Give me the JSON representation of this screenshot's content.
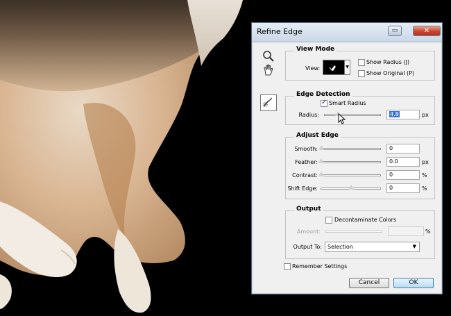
{
  "dialog": {
    "title": "Refine Edge",
    "tools": {
      "zoom": "zoom-icon",
      "hand": "hand-icon",
      "refine": "refine-radius-brush-icon"
    },
    "view_mode": {
      "label": "View Mode",
      "view_label": "View:",
      "show_radius": {
        "label": "Show Radius (J)",
        "checked": false
      },
      "show_original": {
        "label": "Show Original (P)",
        "checked": false
      }
    },
    "edge_detection": {
      "label": "Edge Detection",
      "smart_radius": {
        "label": "Smart Radius",
        "checked": true
      },
      "radius": {
        "label": "Radius:",
        "value": "4.8",
        "unit": "px",
        "slider": 0.4
      }
    },
    "adjust_edge": {
      "label": "Adjust Edge",
      "smooth": {
        "label": "Smooth:",
        "value": "0",
        "unit": "",
        "slider": 0.0
      },
      "feather": {
        "label": "Feather:",
        "value": "0.0",
        "unit": "px",
        "slider": 0.0
      },
      "contrast": {
        "label": "Contrast:",
        "value": "0",
        "unit": "%",
        "slider": 0.0
      },
      "shift_edge": {
        "label": "Shift Edge:",
        "value": "0",
        "unit": "%",
        "slider": 0.5
      }
    },
    "output": {
      "label": "Output",
      "decontaminate": {
        "label": "Decontaminate Colors",
        "checked": false
      },
      "amount": {
        "label": "Amount:",
        "value": "",
        "unit": "%"
      },
      "output_to": {
        "label": "Output To:",
        "selected": "Selection"
      }
    },
    "remember": {
      "label": "Remember Settings",
      "checked": false
    },
    "buttons": {
      "cancel": "Cancel",
      "ok": "OK"
    }
  }
}
